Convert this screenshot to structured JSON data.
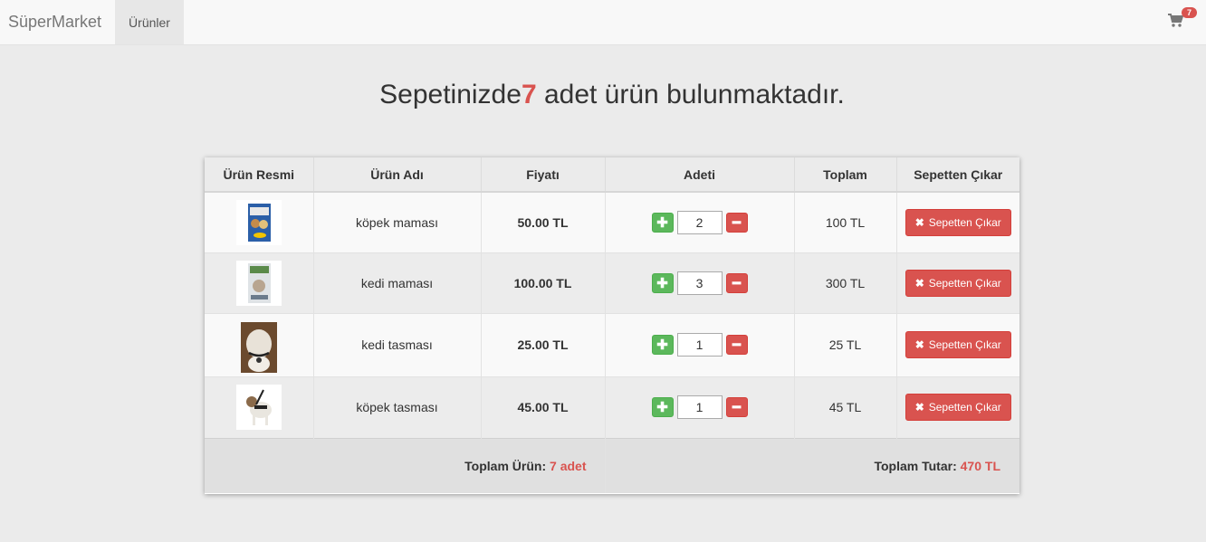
{
  "navbar": {
    "brand": "SüperMarket",
    "products_link": "Ürünler",
    "cart_icon": "shopping-cart-icon",
    "cart_badge": "7"
  },
  "headline": {
    "prefix": "Sepetinizde",
    "count": "7",
    "suffix": " adet ürün bulunmaktadır."
  },
  "table": {
    "headers": [
      "Ürün Resmi",
      "Ürün Adı",
      "Fiyatı",
      "Adeti",
      "Toplam",
      "Sepetten Çıkar"
    ],
    "rows": [
      {
        "name": "köpek maması",
        "price": "50.00 TL",
        "qty": "2",
        "total": "100 TL",
        "remove_label": "Sepetten Çıkar",
        "image": "dog-food-bag"
      },
      {
        "name": "kedi maması",
        "price": "100.00 TL",
        "qty": "3",
        "total": "300 TL",
        "remove_label": "Sepetten Çıkar",
        "image": "cat-food-bag"
      },
      {
        "name": "kedi tasması",
        "price": "25.00 TL",
        "qty": "1",
        "total": "25 TL",
        "remove_label": "Sepetten Çıkar",
        "image": "cat-collar-photo"
      },
      {
        "name": "köpek tasması",
        "price": "45.00 TL",
        "qty": "1",
        "total": "45 TL",
        "remove_label": "Sepetten Çıkar",
        "image": "dog-leash-photo"
      }
    ],
    "footer": {
      "total_items_label": "Toplam Ürün:",
      "total_items_value": "7 adet",
      "total_amount_label": "Toplam Tutar:",
      "total_amount_value": "470 TL"
    }
  },
  "colors": {
    "accent_red": "#d9534f",
    "plus_green": "#5cb85c"
  }
}
